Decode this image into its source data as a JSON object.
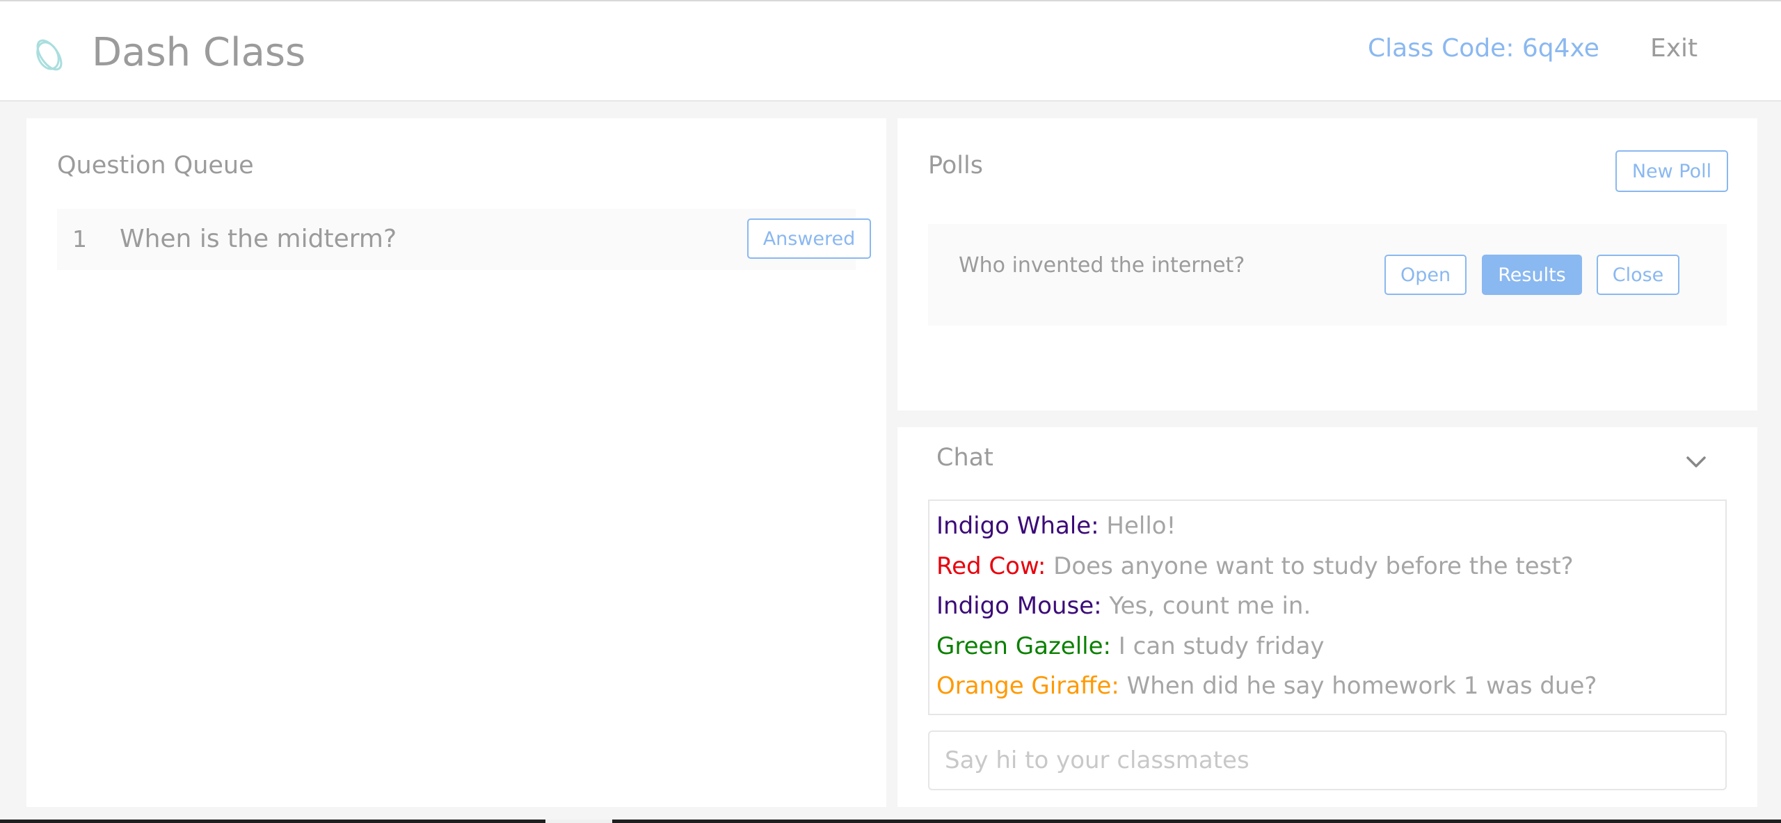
{
  "app": {
    "title": "Dash Class",
    "logo_icon": "orbit-logo-icon",
    "class_code": "Class Code: 6q4xe",
    "exit_label": "Exit"
  },
  "colors": {
    "accent": "#8ab8f0",
    "muted_text": "#9b9b9b",
    "background": "#f5f5f5"
  },
  "question_queue": {
    "heading": "Question Queue",
    "items": [
      {
        "number": "1",
        "text": "When is the midterm?",
        "status_label": "Answered"
      }
    ]
  },
  "polls": {
    "heading": "Polls",
    "new_poll_label": "New Poll",
    "items": [
      {
        "question": "Who invented the internet?",
        "open_label": "Open",
        "results_label": "Results",
        "close_label": "Close"
      }
    ]
  },
  "chat": {
    "heading": "Chat",
    "toggle_icon": "chevron-down-icon",
    "messages": [
      {
        "sender": "Indigo Whale:",
        "text": " Hello!",
        "color": "#3b0a78"
      },
      {
        "sender": "Red Cow:",
        "text": " Does anyone want to study before the test?",
        "color": "#e8000b"
      },
      {
        "sender": "Indigo Mouse:",
        "text": " Yes, count me in.",
        "color": "#3b0a78"
      },
      {
        "sender": "Green Gazelle:",
        "text": " I can study friday",
        "color": "#0a8000"
      },
      {
        "sender": "Orange Giraffe:",
        "text": " When did he say homework 1 was due?",
        "color": "#ff9900"
      }
    ],
    "input_placeholder": "Say hi to your classmates",
    "input_value": ""
  }
}
